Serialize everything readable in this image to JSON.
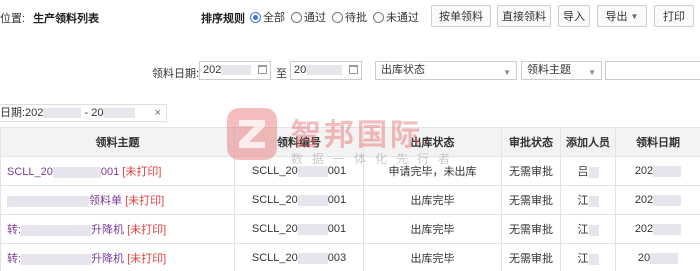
{
  "breadcrumb": {
    "prefix": "位置:",
    "current": "生产领料列表"
  },
  "sort": {
    "label": "排序规则",
    "options": [
      {
        "label": "全部",
        "selected": true
      },
      {
        "label": "通过",
        "selected": false
      },
      {
        "label": "待批",
        "selected": false
      },
      {
        "label": "未通过",
        "selected": false
      }
    ]
  },
  "toolbar": {
    "by_order": "按单领料",
    "direct": "直接领料",
    "import": "导入",
    "export": "导出",
    "print": "打印"
  },
  "filters": {
    "date_label": "领料日期:",
    "date_from": "202",
    "to_label": "至",
    "date_to": "20",
    "status_placeholder": "出库状态",
    "subject_placeholder": "领料主题"
  },
  "chip": {
    "label": "日期:202",
    "separator": "- 20"
  },
  "table": {
    "headers": [
      "领料主题",
      "领料编号",
      "出库状态",
      "审批状态",
      "添加人员",
      "领料日期"
    ],
    "rows": [
      {
        "subject_prefix": "SCLL_20",
        "subject_suffix": "001",
        "mark": "[未打印]",
        "code_prefix": "SCLL_20",
        "code_suffix": "001",
        "status": "申请完毕，未出库",
        "approval": "无需审批",
        "adder": "吕",
        "date": "202"
      },
      {
        "subject_prefix": "",
        "subject_suffix": "领料单",
        "mark": "[未打印]",
        "code_prefix": "SCLL_20",
        "code_suffix": "001",
        "status": "出库完毕",
        "approval": "无需审批",
        "adder": "江",
        "date": "202"
      },
      {
        "subject_prefix": "转:",
        "subject_suffix": "升降机",
        "mark": "[未打印]",
        "code_prefix": "SCLL_20",
        "code_suffix": "001",
        "status": "出库完毕",
        "approval": "无需审批",
        "adder": "江",
        "date": "202"
      },
      {
        "subject_prefix": "转:",
        "subject_suffix": "升降机",
        "mark": "[未打印]",
        "code_prefix": "SCLL_20",
        "code_suffix": "003",
        "status": "出库完毕",
        "approval": "无需审批",
        "adder": "江",
        "date": "20"
      }
    ]
  },
  "watermark": {
    "title": "智邦国际",
    "subtitle": "数据一体化先行者"
  },
  "colors": {
    "accent": "#3a78d6",
    "subject_link": "#7a3a96",
    "unprinted": "#e04040",
    "header_bg": "#f3f3f3"
  },
  "icons": [
    "calendar-icon",
    "chevron-down-icon",
    "close-icon",
    "zhibang-logo"
  ]
}
